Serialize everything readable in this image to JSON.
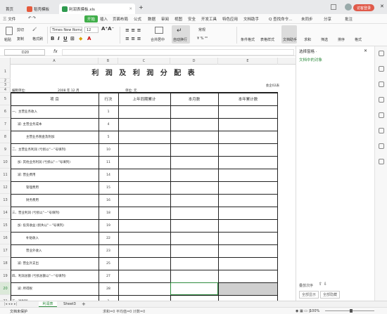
{
  "titlebar": {
    "tab_home": "首页",
    "tab_docer": "稻壳模板",
    "tab_file": "利润表摸板.xls",
    "new_tab": "+",
    "login": "访客登录"
  },
  "menubar": {
    "file": "三 文件",
    "items": [
      "开始",
      "插入",
      "页面布局",
      "公式",
      "数据",
      "审阅",
      "视图",
      "安全",
      "开发工具",
      "特色应用",
      "文档助手"
    ],
    "search": "Q 查找命令...",
    "sync": "未同步",
    "share": "分享",
    "annotate": "批注"
  },
  "ribbon": {
    "paste": "粘贴",
    "cut": "剪切",
    "copy": "复制",
    "format_painter": "格式刷",
    "font_name": "Times New Roma",
    "font_size": "12",
    "merge": "合并居中",
    "wrap": "自动换行",
    "number_format": "常规",
    "cond_format": "条件格式",
    "table_style": "表格样式",
    "doc_helper": "文档助手",
    "sum": "求和",
    "filter": "筛选",
    "sort": "排序",
    "format": "格式"
  },
  "formula_bar": {
    "cell_ref": "D20",
    "fx": "fx"
  },
  "sheet": {
    "columns": [
      "A",
      "B",
      "C",
      "D",
      "E"
    ],
    "rows": [
      "1",
      "2",
      "3",
      "4",
      "5",
      "6",
      "7",
      "8",
      "9",
      "10",
      "11",
      "12",
      "13",
      "14",
      "15",
      "16",
      "17",
      "18",
      "19",
      "20",
      "21",
      "22"
    ],
    "title": "利 润 及 利 润 分 配 表",
    "form_no": "会企02表",
    "unit_label": "编制单位:",
    "date_label": "2008  年   12   月",
    "currency_label": "单位: 元",
    "headers": [
      "项          目",
      "行次",
      "上年同期累计",
      "本月数",
      "本年累计数"
    ],
    "items": [
      {
        "label": "一、主营业务收入",
        "line": "1"
      },
      {
        "label": "减: 主营业务成本",
        "line": "4"
      },
      {
        "label": "主营业务税金及附加",
        "line": "5"
      },
      {
        "label": "二、主营业务利润 (亏损以\"－\"号填列)",
        "line": "10"
      },
      {
        "label": "加: 其他业务利润 (亏损以\"－\"号填列)",
        "line": "11"
      },
      {
        "label": "减: 营业费用",
        "line": "14"
      },
      {
        "label": "管理费用",
        "line": "15"
      },
      {
        "label": "财务费用",
        "line": "16"
      },
      {
        "label": "三、营业利润 (亏损以\"－\"号填列)",
        "line": "18"
      },
      {
        "label": "加: 投资收益 (损失以\"－\"号填列)",
        "line": "19"
      },
      {
        "label": "补贴收入",
        "line": "22"
      },
      {
        "label": "营业外收入",
        "line": "23"
      },
      {
        "label": "减: 营业外支出",
        "line": "25"
      },
      {
        "label": "四、利润总额 (亏损总额以\"－\"号填列)",
        "line": "27"
      },
      {
        "label": "减: 所得税",
        "line": "28"
      },
      {
        "label": "五、净利润",
        "line": "1"
      }
    ]
  },
  "sidepane": {
    "title": "选择窗格 ·",
    "section": "文档中的对象",
    "order_label": "叠放次序",
    "show_all": "全部显示",
    "hide_all": "全部隐藏"
  },
  "sheet_tabs": [
    "利润表",
    "Sheet3"
  ],
  "statusbar": {
    "protect": "文档未保护",
    "stats": "求和=0  平均值=0  计数=0",
    "zoom": "100%"
  }
}
